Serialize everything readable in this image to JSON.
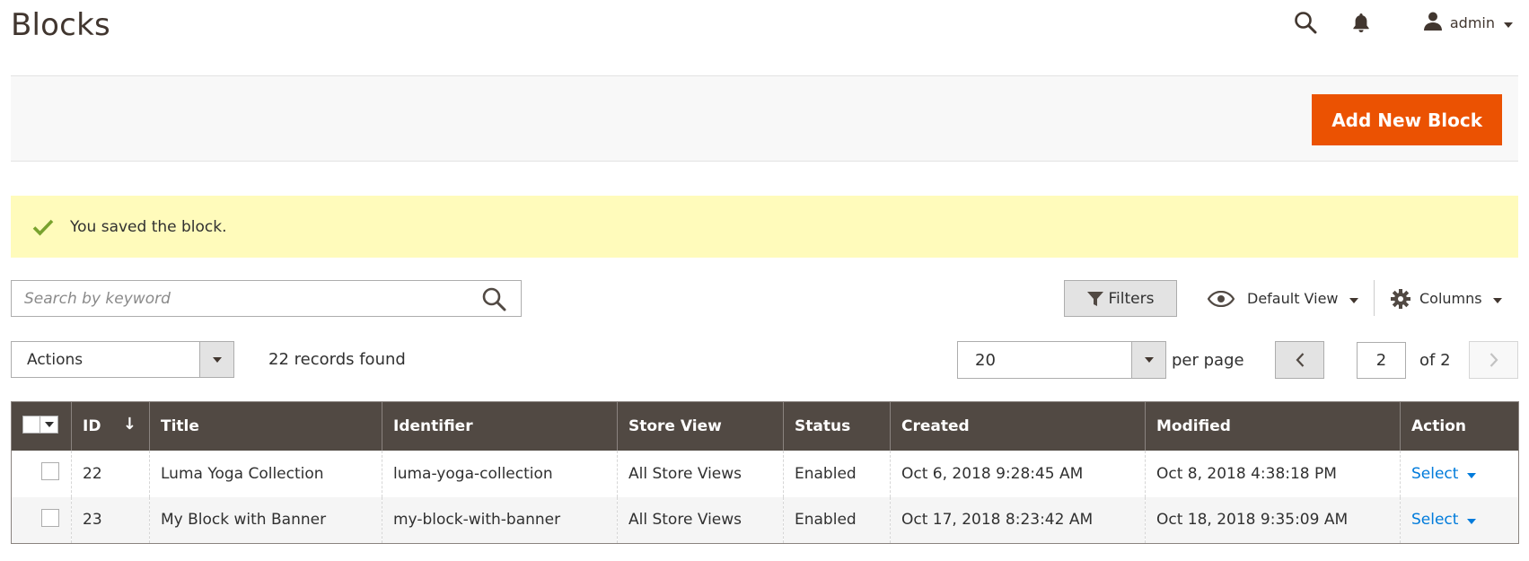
{
  "header": {
    "title": "Blocks",
    "user_name": "admin"
  },
  "page_actions": {
    "add_button_label": "Add New Block"
  },
  "message": {
    "text": "You saved the block."
  },
  "toolbar": {
    "search_placeholder": "Search by keyword",
    "filters_label": "Filters",
    "view_label": "Default View",
    "columns_label": "Columns",
    "actions_label": "Actions",
    "records_found": "22 records found",
    "per_page_value": "20",
    "per_page_label": "per page",
    "current_page": "2",
    "of_pages": "of 2"
  },
  "grid": {
    "columns": [
      "ID",
      "Title",
      "Identifier",
      "Store View",
      "Status",
      "Created",
      "Modified",
      "Action"
    ],
    "rows": [
      {
        "id": "22",
        "title": "Luma Yoga Collection",
        "identifier": "luma-yoga-collection",
        "store_view": "All Store Views",
        "status": "Enabled",
        "created": "Oct 6, 2018 9:28:45 AM",
        "modified": "Oct 8, 2018 4:38:18 PM",
        "action": "Select"
      },
      {
        "id": "23",
        "title": "My Block with Banner",
        "identifier": "my-block-with-banner",
        "store_view": "All Store Views",
        "status": "Enabled",
        "created": "Oct 17, 2018 8:23:42 AM",
        "modified": "Oct 18, 2018 9:35:09 AM",
        "action": "Select"
      }
    ]
  },
  "colors": {
    "accent": "#eb5202",
    "grid_header": "#514943",
    "message_bg": "#fffbbb",
    "success_check": "#79a22e",
    "link": "#007bdb"
  }
}
